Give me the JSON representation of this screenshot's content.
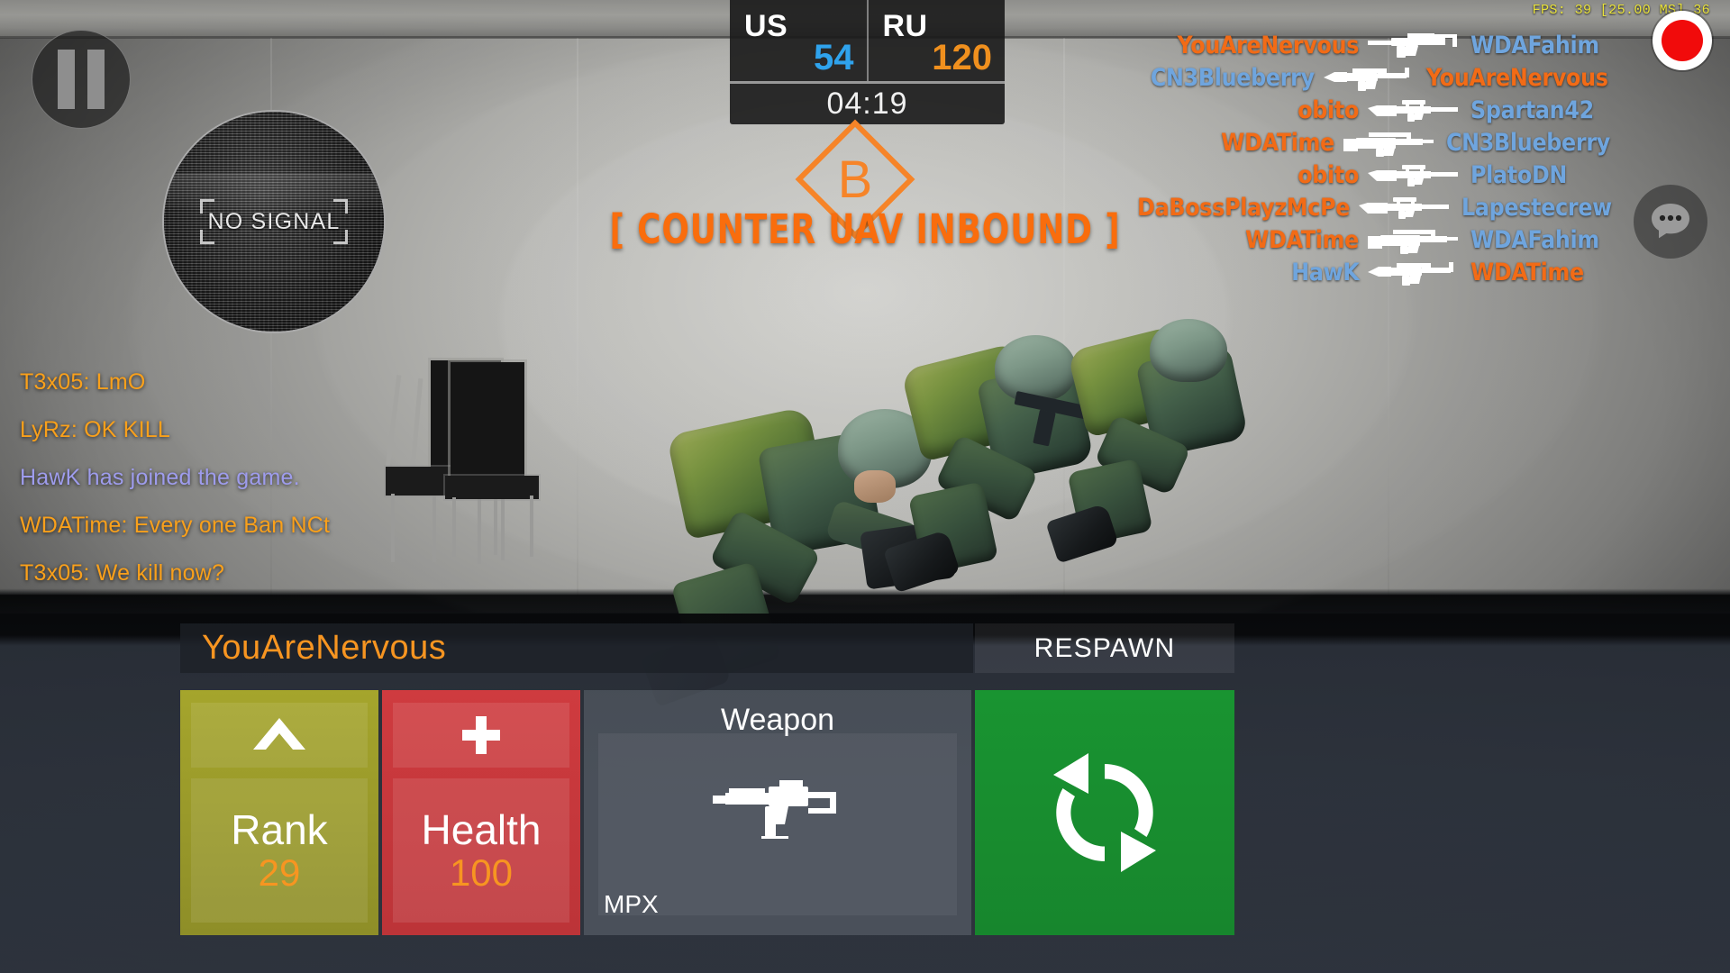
{
  "hud": {
    "pause_button": "pause",
    "record_button": "record",
    "chat_button": "chat"
  },
  "minimap": {
    "status_text": "NO SIGNAL"
  },
  "scoreboard": {
    "teams": [
      {
        "tag": "US",
        "score": "54",
        "color": "#2FA3ED"
      },
      {
        "tag": "RU",
        "score": "120",
        "color": "#F0901E"
      }
    ],
    "timer": "04:19"
  },
  "performance": {
    "fps_text": "FPS: 39 [25.00 MS] 36"
  },
  "objective": {
    "letter": "B",
    "color": "#F68428"
  },
  "alert": {
    "banner_text": "[ COUNTER UAV INBOUND ]",
    "color": "#F96D0D"
  },
  "killfeed": {
    "colors": {
      "enemy": "#F26B16",
      "friendly": "#6FA5DE"
    },
    "entries": [
      {
        "killer": "YouAreNervous",
        "killer_team": "enemy",
        "weapon": "smg-mpx-icon",
        "victim": "WDAFahim",
        "victim_team": "friendly"
      },
      {
        "killer": "CN3Blueberry",
        "killer_team": "friendly",
        "weapon": "rifle-m4-icon",
        "victim": "YouAreNervous",
        "victim_team": "enemy"
      },
      {
        "killer": "obito",
        "killer_team": "enemy",
        "weapon": "sniper-bolt-icon",
        "victim": "Spartan42",
        "victim_team": "friendly"
      },
      {
        "killer": "WDATime",
        "killer_team": "enemy",
        "weapon": "rifle-scar-icon",
        "victim": "CN3Blueberry",
        "victim_team": "friendly"
      },
      {
        "killer": "obito",
        "killer_team": "enemy",
        "weapon": "sniper-bolt-icon",
        "victim": "PlatoDN",
        "victim_team": "friendly"
      },
      {
        "killer": "DaBossPlayzMcPe",
        "killer_team": "enemy",
        "weapon": "sniper-bolt-icon",
        "victim": "Lapestecrew",
        "victim_team": "friendly"
      },
      {
        "killer": "WDATime",
        "killer_team": "enemy",
        "weapon": "rifle-scar-icon",
        "victim": "WDAFahim",
        "victim_team": "friendly"
      },
      {
        "killer": "HawK",
        "killer_team": "friendly",
        "weapon": "rifle-m4-icon",
        "victim": "WDATime",
        "victim_team": "enemy"
      }
    ]
  },
  "chat": {
    "colors": {
      "message": "#F9A01B",
      "system": "#9E9CEC"
    },
    "lines": [
      {
        "text": "T3x05: LmO",
        "kind": "message"
      },
      {
        "text": "LyRz: OK KILL",
        "kind": "message"
      },
      {
        "text": "HawK has joined the game.",
        "kind": "system"
      },
      {
        "text": "WDATime: Every one Ban NCt",
        "kind": "message"
      },
      {
        "text": "T3x05: We kill now?",
        "kind": "message"
      }
    ]
  },
  "player_hud": {
    "name": "YouAreNervous",
    "rank": {
      "label": "Rank",
      "value": "29",
      "icon": "chevron-rank-icon"
    },
    "health": {
      "label": "Health",
      "value": "100",
      "icon": "medical-cross-icon"
    },
    "weapon": {
      "title": "Weapon",
      "name": "MPX",
      "icon": "smg-mpx-icon"
    },
    "respawn": {
      "label": "RESPAWN",
      "icon": "refresh-cycle-icon"
    }
  }
}
